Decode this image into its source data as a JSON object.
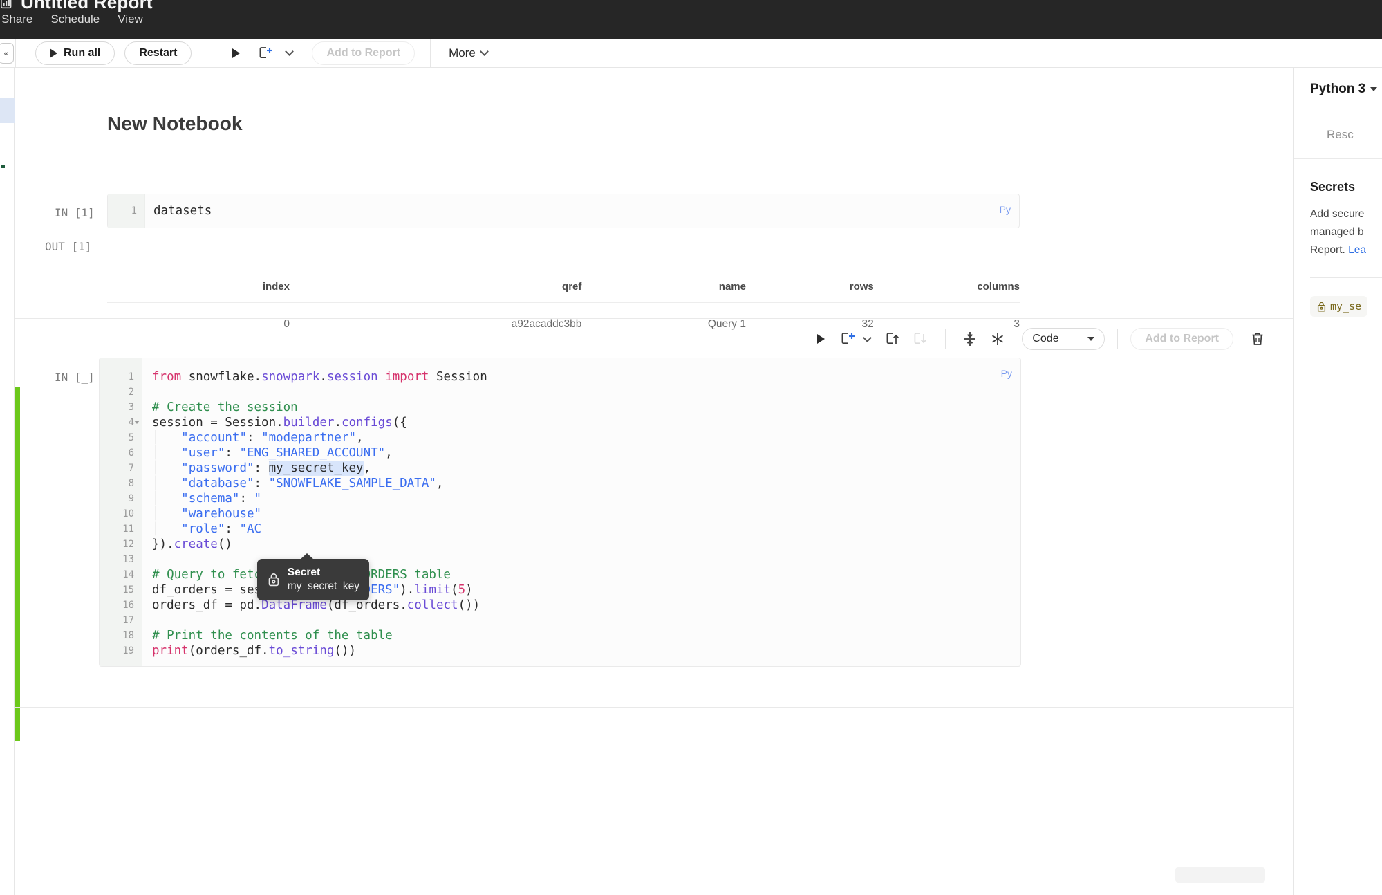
{
  "topbar": {
    "brand_icon": "report-logo-icon",
    "title": "Untitled Report",
    "menu": [
      "Share",
      "Schedule",
      "View"
    ]
  },
  "toolbar": {
    "run_all_label": "Run all",
    "restart_label": "Restart",
    "run_icon": "play-icon",
    "add_cell_icon": "add-cell-icon",
    "add_to_report_label": "Add to Report",
    "more_label": "More",
    "collapse_icon": "collapse-panel-icon"
  },
  "notebook": {
    "title": "New Notebook"
  },
  "cell1": {
    "in_label": "IN [1]",
    "out_label": "OUT [1]",
    "lang_badge": "Py",
    "line_number": "1",
    "code": "datasets",
    "output_table": {
      "headers": [
        "index",
        "qref",
        "name",
        "rows",
        "columns"
      ],
      "rows": [
        [
          "0",
          "a92acaddc3bb",
          "Query 1",
          "32",
          "3"
        ]
      ]
    }
  },
  "cell2": {
    "in_label": "IN [_]",
    "lang_badge": "Py",
    "cell_type": "Code",
    "tools": {
      "run_icon": "play-icon",
      "add_cell_icon": "add-cell-icon",
      "move_up_icon": "move-cell-up-icon",
      "move_down_icon": "move-cell-down-icon",
      "collapse_icon": "collapse-cell-icon",
      "clear_icon": "clear-output-icon",
      "add_to_report_label": "Add to Report",
      "delete_icon": "trash-icon"
    },
    "lines": [
      {
        "n": "1",
        "tokens": [
          {
            "t": "from ",
            "c": "kw"
          },
          {
            "t": "snowflake",
            "c": "txt"
          },
          {
            "t": ".",
            "c": "txt"
          },
          {
            "t": "snowpark",
            "c": "mod"
          },
          {
            "t": ".",
            "c": "txt"
          },
          {
            "t": "session",
            "c": "mod"
          },
          {
            "t": " ",
            "c": "txt"
          },
          {
            "t": "import",
            "c": "kw"
          },
          {
            "t": " Session",
            "c": "txt"
          }
        ]
      },
      {
        "n": "2",
        "tokens": []
      },
      {
        "n": "3",
        "tokens": [
          {
            "t": "# Create the session",
            "c": "com"
          }
        ]
      },
      {
        "n": "4",
        "fold": true,
        "tokens": [
          {
            "t": "session = Session",
            "c": "txt"
          },
          {
            "t": ".",
            "c": "txt"
          },
          {
            "t": "builder",
            "c": "fn"
          },
          {
            "t": ".",
            "c": "txt"
          },
          {
            "t": "configs",
            "c": "fn"
          },
          {
            "t": "({",
            "c": "txt"
          }
        ]
      },
      {
        "n": "5",
        "indent": true,
        "tokens": [
          {
            "t": "\"account\"",
            "c": "key"
          },
          {
            "t": ": ",
            "c": "txt"
          },
          {
            "t": "\"modepartner\"",
            "c": "str"
          },
          {
            "t": ",",
            "c": "txt"
          }
        ]
      },
      {
        "n": "6",
        "indent": true,
        "tokens": [
          {
            "t": "\"user\"",
            "c": "key"
          },
          {
            "t": ": ",
            "c": "txt"
          },
          {
            "t": "\"ENG_SHARED_ACCOUNT\"",
            "c": "str"
          },
          {
            "t": ",",
            "c": "txt"
          }
        ]
      },
      {
        "n": "7",
        "indent": true,
        "secret": true,
        "tokens": [
          {
            "t": "\"password\"",
            "c": "key"
          },
          {
            "t": ": ",
            "c": "txt"
          },
          {
            "t": "my_secret_key",
            "c": "sel"
          },
          {
            "t": ",",
            "c": "txt"
          }
        ]
      },
      {
        "n": "8",
        "indent": true,
        "tokens": [
          {
            "t": "\"database\"",
            "c": "key"
          },
          {
            "t": ": ",
            "c": "txt"
          },
          {
            "t": "\"SNOWFLAKE_SAMPLE_DATA\"",
            "c": "str"
          },
          {
            "t": ",",
            "c": "txt"
          }
        ]
      },
      {
        "n": "9",
        "indent": true,
        "tokens": [
          {
            "t": "\"schema\"",
            "c": "key"
          },
          {
            "t": ": ",
            "c": "txt"
          },
          {
            "t": "\"",
            "c": "str"
          }
        ]
      },
      {
        "n": "10",
        "indent": true,
        "tokens": [
          {
            "t": "\"warehouse\"",
            "c": "key"
          }
        ]
      },
      {
        "n": "11",
        "indent": true,
        "tokens": [
          {
            "t": "\"role\"",
            "c": "key"
          },
          {
            "t": ": ",
            "c": "txt"
          },
          {
            "t": "\"AC",
            "c": "str"
          }
        ]
      },
      {
        "n": "12",
        "tokens": [
          {
            "t": "}).",
            "c": "txt"
          },
          {
            "t": "create",
            "c": "fn"
          },
          {
            "t": "()",
            "c": "txt"
          }
        ]
      },
      {
        "n": "13",
        "tokens": []
      },
      {
        "n": "14",
        "tokens": [
          {
            "t": "# Query to fetch contents of ORDERS table",
            "c": "com"
          }
        ]
      },
      {
        "n": "15",
        "tokens": [
          {
            "t": "df_orders = session",
            "c": "txt"
          },
          {
            "t": ".",
            "c": "txt"
          },
          {
            "t": "table",
            "c": "fn"
          },
          {
            "t": "(",
            "c": "txt"
          },
          {
            "t": "\"ORDERS\"",
            "c": "str"
          },
          {
            "t": ").",
            "c": "txt"
          },
          {
            "t": "limit",
            "c": "fn"
          },
          {
            "t": "(",
            "c": "txt"
          },
          {
            "t": "5",
            "c": "num"
          },
          {
            "t": ")",
            "c": "txt"
          }
        ]
      },
      {
        "n": "16",
        "tokens": [
          {
            "t": "orders_df = pd",
            "c": "txt"
          },
          {
            "t": ".",
            "c": "txt"
          },
          {
            "t": "DataFrame",
            "c": "fn"
          },
          {
            "t": "(df_orders",
            "c": "txt"
          },
          {
            "t": ".",
            "c": "txt"
          },
          {
            "t": "collect",
            "c": "fn"
          },
          {
            "t": "())",
            "c": "txt"
          }
        ]
      },
      {
        "n": "17",
        "tokens": []
      },
      {
        "n": "18",
        "tokens": [
          {
            "t": "# Print the contents of the table",
            "c": "com"
          }
        ]
      },
      {
        "n": "19",
        "tokens": [
          {
            "t": "print",
            "c": "kw"
          },
          {
            "t": "(orders_df",
            "c": "txt"
          },
          {
            "t": ".",
            "c": "txt"
          },
          {
            "t": "to_string",
            "c": "fn"
          },
          {
            "t": "())",
            "c": "txt"
          }
        ]
      }
    ]
  },
  "tooltip": {
    "icon": "lock-icon",
    "title": "Secret",
    "subtitle": "my_secret_key"
  },
  "sidebar": {
    "kernel_label": "Python 3",
    "tab_label": "Resc",
    "secrets_heading": "Secrets",
    "secrets_desc_line1": "Add secure",
    "secrets_desc_line2": "managed b",
    "secrets_desc_line3": "Report. ",
    "secrets_link": "Lea",
    "secret_chip_label": "my_se",
    "secret_chip_icon": "lock-icon"
  },
  "colors": {
    "accent_green": "#6cc81b",
    "link_blue": "#2f6fe4",
    "badge_blue": "#7b9cf0",
    "secret_gold": "#7a6a1e",
    "topbar_bg": "#262626"
  }
}
